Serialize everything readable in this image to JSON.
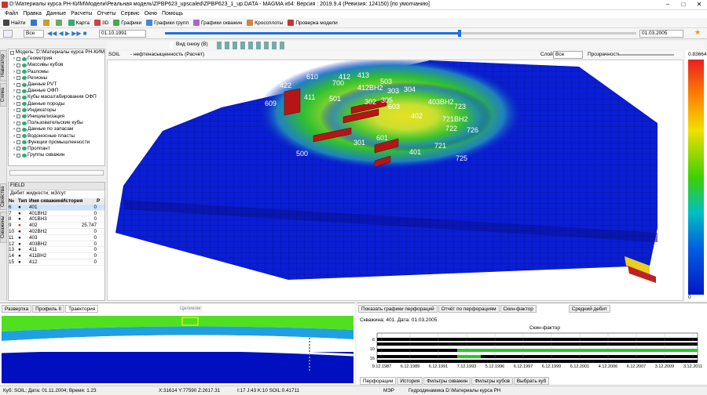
{
  "titlebar": {
    "title": "D:\\Материалы курса РН-КИМ\\Модели\\Реальная модель\\ZPBP623_upscaled\\ZPBP623_1_up.DATA - MAGMA x64: Версия : 2019.9.4 (Ревизия: 124150) [по умолчанию]"
  },
  "menu": [
    "Файл",
    "Правка",
    "Данные",
    "Расчеты",
    "Отчеты",
    "Сервис",
    "Окно",
    "Помощь"
  ],
  "toolbar1": {
    "home": "Найти",
    "map": "Карта",
    "three_d": "3D",
    "graphs": "Графики",
    "group_graphs": "Графики групп",
    "well_graphs": "Графики скважин",
    "cross_plots": "Кроссплоты",
    "model_check": "Проверка модели"
  },
  "toolbar2": {
    "filter": "Все",
    "start_date": "01.10.1991",
    "end_date": "01.03.2005",
    "progress": 0.625
  },
  "navigator": {
    "tab_navigator": "Навигатор",
    "tab_schema": "Схема",
    "model_label": "Модель: D:\\Материалы курса РН-КИМ",
    "items": [
      "Геометрия",
      "Массивы кубов",
      "Разломы",
      "Регионы",
      "Данные PVT",
      "Данные ОФП",
      "Кубы масштабирования ОФП",
      "Данные породы",
      "Индикаторы",
      "Инициализация",
      "Пользовательские кубы",
      "Данные по запасам",
      "Водоносные пласты",
      "Функции промышленности",
      "Проппант",
      "Группы скважин"
    ]
  },
  "properties": {
    "tab_props": "Свойства",
    "tab_wells": "Скважины",
    "field": "FIELD",
    "param": "Дебит жидкости, м3/сут",
    "headers": [
      "№",
      "Тип",
      "Имя скважины",
      "История",
      "Р"
    ],
    "rows": [
      {
        "n": "6",
        "name": "401",
        "hist": "0"
      },
      {
        "n": "7",
        "name": "401BH2",
        "hist": "0"
      },
      {
        "n": "8",
        "name": "401BH3",
        "hist": "0"
      },
      {
        "n": "9",
        "name": "402",
        "hist": "25.747"
      },
      {
        "n": "10",
        "name": "402BH2",
        "hist": "0"
      },
      {
        "n": "11",
        "name": "403",
        "hist": "0"
      },
      {
        "n": "12",
        "name": "403BH2",
        "hist": "0"
      },
      {
        "n": "13",
        "name": "411",
        "hist": "0"
      },
      {
        "n": "14",
        "name": "411BH2",
        "hist": "0"
      },
      {
        "n": "15",
        "name": "412",
        "hist": "0"
      }
    ]
  },
  "view": {
    "cube": "SOIL",
    "cube_desc": "- нефтенасыщенность (Расчет)",
    "view_mode": "Вид снизу (В)",
    "layer_label": "Слой",
    "layer_value": "Все",
    "transparency_label": "Прозрачность",
    "scale_max": "0.83664",
    "scale_min": "0",
    "wells": [
      "610",
      "422",
      "700",
      "412",
      "413",
      "503",
      "412BH2",
      "303",
      "304",
      "609",
      "411",
      "501",
      "302",
      "305",
      "603",
      "403BH2",
      "723",
      "402",
      "721BH2",
      "722",
      "726",
      "301",
      "601",
      "721",
      "500",
      "401",
      "725"
    ]
  },
  "bottom_left": {
    "tabs": [
      "Развертка",
      "Профиль II",
      "Траектория"
    ],
    "whole": "Целиком"
  },
  "bottom_right": {
    "show_perf": "Показать графики перфораций",
    "perf_report": "Отчёт по перфорациям",
    "skin": "Скин-фактор",
    "avg_rate": "Средний дебит",
    "well_date": "Скважина: 401. Дата: 01.03.2005",
    "chart_title": "Скин-фактор",
    "dates": [
      "9.12.1987",
      "6.12.1989",
      "6.12.1991",
      "7.12.1993",
      "5.12.1996",
      "6.12.1997",
      "6.12.1999",
      "6.12.2001",
      "4.12.2006",
      "6.12.2007",
      "3.12.2009",
      "3.12.2011"
    ],
    "yticks": [
      "6",
      "10",
      "16"
    ],
    "tabs": [
      "Перфорации",
      "История",
      "Фильтры скважин",
      "Фильтры кубов",
      "Выбрать куб"
    ]
  },
  "status": {
    "cube_info": "Куб: SOIL; Дата: 01.11.2004; Время: 1.23",
    "coords": "X:31614 Y:77590 Z:2617.31",
    "ijk": "I:17 J:43 K:10 SOIL:0.41711",
    "mode": "МЭР",
    "gidro": "Гидродинамика D:\\Материалы курса РН"
  },
  "colors": {
    "accent": "#1e6fe0",
    "high": "#e82020",
    "low": "#0018c8"
  }
}
